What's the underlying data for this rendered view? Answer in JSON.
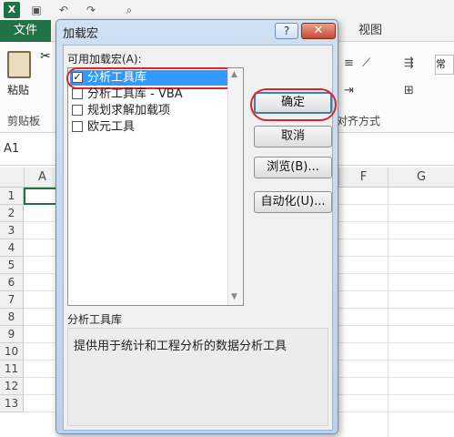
{
  "excel": {
    "logo": "X",
    "file_tab": "文件",
    "view_tab": "视图",
    "paste_label": "粘贴",
    "clipboard_group": "剪贴板",
    "alignment_group": "对齐方式",
    "style_label": "常",
    "name_box": "A1",
    "columns": [
      "A",
      "F",
      "G"
    ],
    "rows": [
      "1",
      "2",
      "3",
      "4",
      "5",
      "6",
      "7",
      "8",
      "9",
      "10",
      "11",
      "12",
      "13"
    ]
  },
  "dialog": {
    "title": "加载宏",
    "help": "?",
    "close": "✕",
    "available_label": "可用加载宏(A):",
    "items": [
      {
        "label": "分析工具库",
        "checked": true,
        "selected": true
      },
      {
        "label": "分析工具库 - VBA",
        "checked": false,
        "selected": false
      },
      {
        "label": "规划求解加载项",
        "checked": false,
        "selected": false
      },
      {
        "label": "欧元工具",
        "checked": false,
        "selected": false
      }
    ],
    "buttons": {
      "ok": "确定",
      "cancel": "取消",
      "browse": "浏览(B)...",
      "automation": "自动化(U)..."
    },
    "description": {
      "group_label": "分析工具库",
      "text": "提供用于统计和工程分析的数据分析工具"
    }
  }
}
